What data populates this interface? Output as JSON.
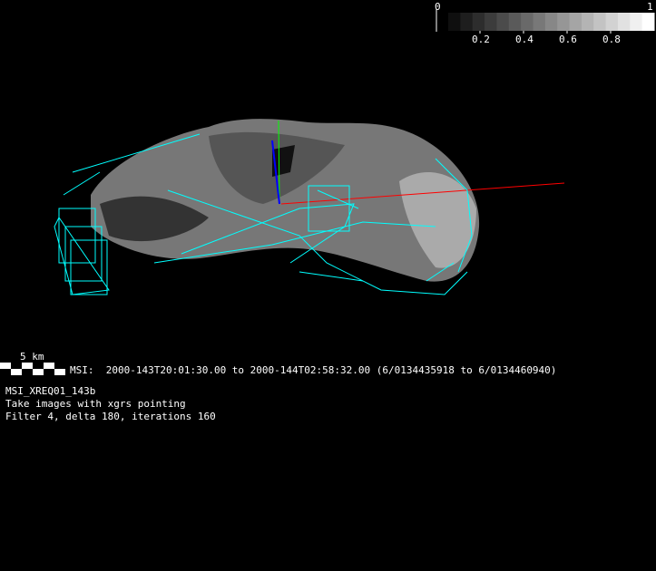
{
  "colorbar": {
    "min_label": "0",
    "max_label": "1",
    "ticks": [
      "0.2",
      "0.4",
      "0.6",
      "0.8"
    ],
    "tick_values": [
      0.2,
      0.4,
      0.6,
      0.8
    ],
    "steps": 17
  },
  "scale_bar": {
    "label": "5 km"
  },
  "info": {
    "time_line": "MSI:  2000-143T20:01:30.00 to 2000-144T02:58:32.00 (6/0134435918 to 6/0134460940)",
    "sequence": "MSI_XREQ01_143b",
    "description": "Take images with xgrs pointing",
    "params": "Filter 4, delta 180, iterations 160"
  },
  "colors": {
    "footprint": "#00ffff",
    "axis_x": "#ff0000",
    "axis_y": "#00ff00",
    "axis_z": "#0000ff"
  }
}
